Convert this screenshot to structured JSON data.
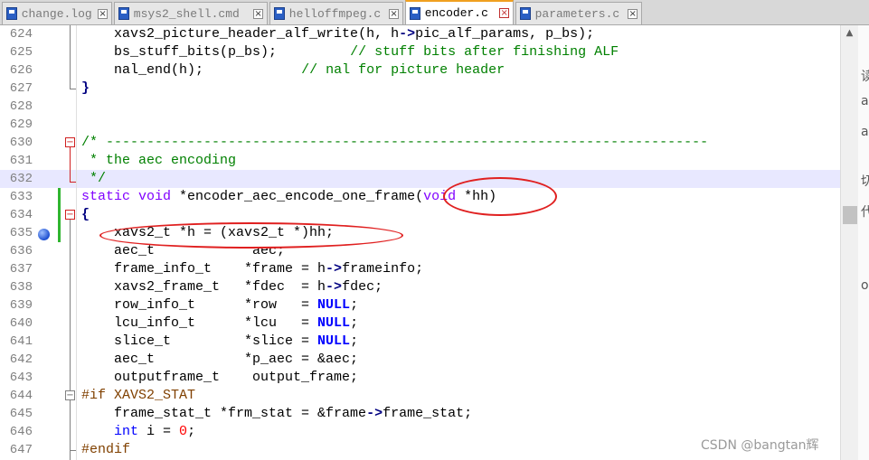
{
  "tabs": [
    {
      "name": "change.log",
      "active": false
    },
    {
      "name": "msys2_shell.cmd",
      "active": false
    },
    {
      "name": "helloffmpeg.c",
      "active": false
    },
    {
      "name": "encoder.c",
      "active": true
    },
    {
      "name": "parameters.c",
      "active": false
    }
  ],
  "lines": [
    {
      "num": "624"
    },
    {
      "num": "625"
    },
    {
      "num": "626"
    },
    {
      "num": "627"
    },
    {
      "num": "628"
    },
    {
      "num": "629"
    },
    {
      "num": "630"
    },
    {
      "num": "631"
    },
    {
      "num": "632"
    },
    {
      "num": "633"
    },
    {
      "num": "634"
    },
    {
      "num": "635"
    },
    {
      "num": "636"
    },
    {
      "num": "637"
    },
    {
      "num": "638"
    },
    {
      "num": "639"
    },
    {
      "num": "640"
    },
    {
      "num": "641"
    },
    {
      "num": "642"
    },
    {
      "num": "643"
    },
    {
      "num": "644"
    },
    {
      "num": "645"
    },
    {
      "num": "646"
    },
    {
      "num": "647"
    }
  ],
  "code": {
    "l624_a": "    xavs2_picture_header_alf_write",
    "l624_b": "(h, h",
    "l624_c": "->",
    "l624_d": "pic_alf_params, p_bs",
    "l624_e": ");",
    "l625_a": "    bs_stuff_bits",
    "l625_b": "(p_bs);         ",
    "l625_c": "// stuff bits after finishing ALF",
    "l626_a": "    nal_end",
    "l626_b": "(h);            ",
    "l626_c": "// nal for picture header",
    "l627": "}",
    "l630": "/* --------------------------------------------------------------------------",
    "l631": " * the aec encoding",
    "l632": " */",
    "l633_kw1": "static",
    "l633_kw2": "void",
    "l633_a": " *encoder_aec_encode_one_frame(",
    "l633_kw3": "void",
    "l633_b": " *hh)",
    "l634": "{",
    "l635_a": "    xavs2_t *h = (xavs2_t *)hh;",
    "l636_a": "    aec_t            aec;",
    "l637_a": "    frame_info_t    *frame = h",
    "l637_op": "->",
    "l637_b": "frameinfo;",
    "l638_a": "    xavs2_frame_t   *fdec  = h",
    "l638_op": "->",
    "l638_b": "fdec;",
    "l639_a": "    row_info_t      *row   = ",
    "l639_n": "NULL",
    "l639_b": ";",
    "l640_a": "    lcu_info_t      *lcu   = ",
    "l640_n": "NULL",
    "l640_b": ";",
    "l641_a": "    slice_t         *slice = ",
    "l641_n": "NULL",
    "l641_b": ";",
    "l642_a": "    aec_t           *p_aec = &aec;",
    "l643_a": "    outputframe_t    output_frame;",
    "l644_a": "#if XAVS2_STAT",
    "l645_a": "    frame_stat_t *frm_stat = &frame",
    "l645_op": "->",
    "l645_b": "frame_stat;",
    "l646_kw": "int",
    "l646_a": " i = ",
    "l646_num": "0",
    "l646_b": ";",
    "l647_a": "#endif"
  },
  "right_glyphs": [
    "读",
    "a",
    "a",
    "切",
    "代",
    "o"
  ],
  "watermark": "CSDN @bangtan辉"
}
